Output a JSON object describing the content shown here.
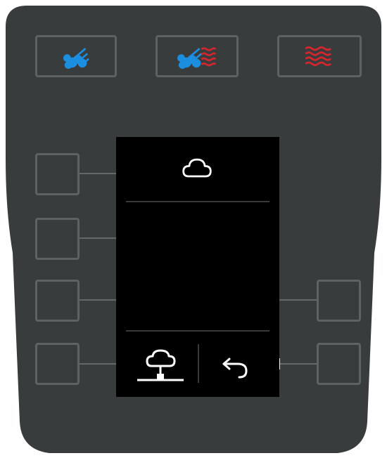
{
  "colors": {
    "body": "#383c3d",
    "button_border": "#5d6263",
    "steam_blue": "#1b8ee0",
    "heat_red": "#d5262d",
    "screen_bg": "#000000",
    "screen_icon": "#ffffff"
  },
  "top_buttons": [
    {
      "name": "steam-mode",
      "icon": "steam-icon"
    },
    {
      "name": "combi-mode",
      "icon": "combi-steam-heat-icon"
    },
    {
      "name": "heat-mode",
      "icon": "heat-waves-icon"
    }
  ],
  "screen": {
    "header_icon": "cloud-icon",
    "footer_left_icon": "cloud-network-icon",
    "footer_right_icon": "back-arrow-icon"
  },
  "side_buttons": {
    "left": [
      "left-button-1",
      "left-button-2",
      "left-button-3",
      "left-button-4"
    ],
    "right": [
      "right-button-1",
      "right-button-2"
    ]
  }
}
